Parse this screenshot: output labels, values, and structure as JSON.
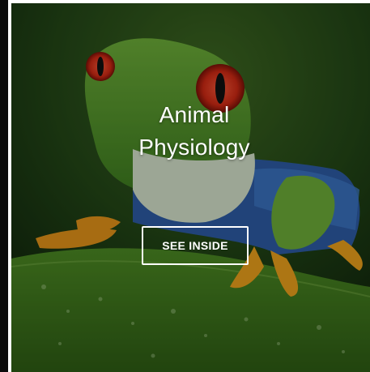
{
  "card": {
    "title_line1": "Animal",
    "title_line2": "Physiology",
    "button_label": "SEE INSIDE",
    "image_subject": "red-eyed tree frog on a leaf"
  },
  "colors": {
    "text": "#ffffff",
    "button_border": "#ffffff",
    "frame_left_border": "#0b0b0b"
  }
}
